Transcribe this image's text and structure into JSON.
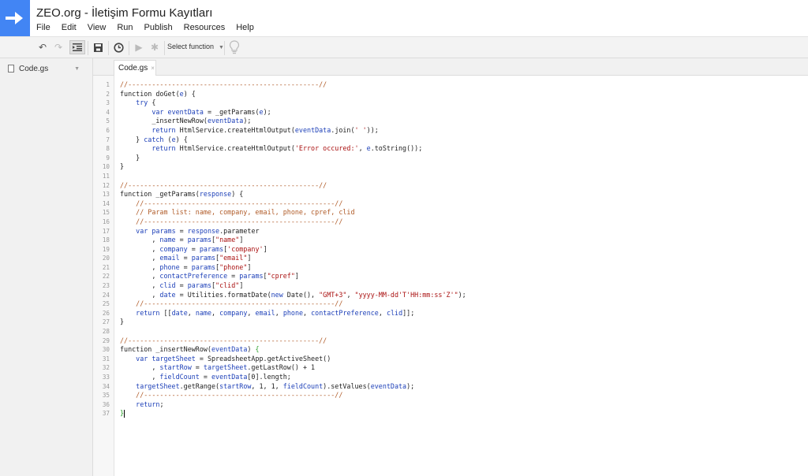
{
  "header": {
    "title": "ZEO.org - İletişim Formu Kayıtları",
    "menu": [
      "File",
      "Edit",
      "View",
      "Run",
      "Publish",
      "Resources",
      "Help"
    ]
  },
  "toolbar": {
    "select_function": "Select function"
  },
  "sidebar": {
    "file": "Code.gs"
  },
  "tabs": [
    {
      "label": "Code.gs",
      "close": "×"
    }
  ],
  "editor": {
    "lines": [
      [
        [
          "c",
          "//------------------------------------------------//"
        ]
      ],
      [
        [
          "p",
          "function doGet("
        ],
        [
          "v",
          "e"
        ],
        [
          "p",
          ") {"
        ]
      ],
      [
        [
          "p",
          "    "
        ],
        [
          "k",
          "try"
        ],
        [
          "p",
          " {"
        ]
      ],
      [
        [
          "p",
          "        "
        ],
        [
          "k",
          "var"
        ],
        [
          "p",
          " "
        ],
        [
          "v",
          "eventData"
        ],
        [
          "p",
          " = _getParams("
        ],
        [
          "v",
          "e"
        ],
        [
          "p",
          ");"
        ]
      ],
      [
        [
          "p",
          "        _insertNewRow("
        ],
        [
          "v",
          "eventData"
        ],
        [
          "p",
          ");"
        ]
      ],
      [
        [
          "p",
          "        "
        ],
        [
          "k",
          "return"
        ],
        [
          "p",
          " HtmlService.createHtmlOutput("
        ],
        [
          "v",
          "eventData"
        ],
        [
          "p",
          ".join("
        ],
        [
          "s",
          "' '"
        ],
        [
          "p",
          "));"
        ]
      ],
      [
        [
          "p",
          "    } "
        ],
        [
          "k",
          "catch"
        ],
        [
          "p",
          " ("
        ],
        [
          "v",
          "e"
        ],
        [
          "p",
          ") {"
        ]
      ],
      [
        [
          "p",
          "        "
        ],
        [
          "k",
          "return"
        ],
        [
          "p",
          " HtmlService.createHtmlOutput("
        ],
        [
          "s",
          "'Error occured:'"
        ],
        [
          "p",
          ", "
        ],
        [
          "v",
          "e"
        ],
        [
          "p",
          ".toString());"
        ]
      ],
      [
        [
          "p",
          "    }"
        ]
      ],
      [
        [
          "p",
          "}"
        ]
      ],
      [],
      [
        [
          "c",
          "//------------------------------------------------//"
        ]
      ],
      [
        [
          "p",
          "function _getParams("
        ],
        [
          "v",
          "response"
        ],
        [
          "p",
          ") {"
        ]
      ],
      [
        [
          "p",
          "    "
        ],
        [
          "c",
          "//------------------------------------------------//"
        ]
      ],
      [
        [
          "p",
          "    "
        ],
        [
          "c",
          "// Param list: name, company, email, phone, cpref, clid"
        ]
      ],
      [
        [
          "p",
          "    "
        ],
        [
          "c",
          "//------------------------------------------------//"
        ]
      ],
      [
        [
          "p",
          "    "
        ],
        [
          "k",
          "var"
        ],
        [
          "p",
          " "
        ],
        [
          "v",
          "params"
        ],
        [
          "p",
          " = "
        ],
        [
          "v",
          "response"
        ],
        [
          "p",
          ".parameter"
        ]
      ],
      [
        [
          "p",
          "        , "
        ],
        [
          "v",
          "name"
        ],
        [
          "p",
          " = "
        ],
        [
          "v",
          "params"
        ],
        [
          "p",
          "["
        ],
        [
          "s",
          "\"name\""
        ],
        [
          "p",
          "]"
        ]
      ],
      [
        [
          "p",
          "        , "
        ],
        [
          "v",
          "company"
        ],
        [
          "p",
          " = "
        ],
        [
          "v",
          "params"
        ],
        [
          "p",
          "["
        ],
        [
          "s",
          "'company'"
        ],
        [
          "p",
          "]"
        ]
      ],
      [
        [
          "p",
          "        , "
        ],
        [
          "v",
          "email"
        ],
        [
          "p",
          " = "
        ],
        [
          "v",
          "params"
        ],
        [
          "p",
          "["
        ],
        [
          "s",
          "\"email\""
        ],
        [
          "p",
          "]"
        ]
      ],
      [
        [
          "p",
          "        , "
        ],
        [
          "v",
          "phone"
        ],
        [
          "p",
          " = "
        ],
        [
          "v",
          "params"
        ],
        [
          "p",
          "["
        ],
        [
          "s",
          "\"phone\""
        ],
        [
          "p",
          "]"
        ]
      ],
      [
        [
          "p",
          "        , "
        ],
        [
          "v",
          "contactPreference"
        ],
        [
          "p",
          " = "
        ],
        [
          "v",
          "params"
        ],
        [
          "p",
          "["
        ],
        [
          "s",
          "\"cpref\""
        ],
        [
          "p",
          "]"
        ]
      ],
      [
        [
          "p",
          "        , "
        ],
        [
          "v",
          "clid"
        ],
        [
          "p",
          " = "
        ],
        [
          "v",
          "params"
        ],
        [
          "p",
          "["
        ],
        [
          "s",
          "\"clid\""
        ],
        [
          "p",
          "]"
        ]
      ],
      [
        [
          "p",
          "        , "
        ],
        [
          "v",
          "date"
        ],
        [
          "p",
          " = Utilities.formatDate("
        ],
        [
          "k",
          "new"
        ],
        [
          "p",
          " Date(), "
        ],
        [
          "s",
          "\"GMT+3\""
        ],
        [
          "p",
          ", "
        ],
        [
          "s",
          "\"yyyy-MM-dd'T'HH:mm:ss'Z'\""
        ],
        [
          "p",
          ");"
        ]
      ],
      [
        [
          "p",
          "    "
        ],
        [
          "c",
          "//------------------------------------------------//"
        ]
      ],
      [
        [
          "p",
          "    "
        ],
        [
          "k",
          "return"
        ],
        [
          "p",
          " [["
        ],
        [
          "v",
          "date"
        ],
        [
          "p",
          ", "
        ],
        [
          "v",
          "name"
        ],
        [
          "p",
          ", "
        ],
        [
          "v",
          "company"
        ],
        [
          "p",
          ", "
        ],
        [
          "v",
          "email"
        ],
        [
          "p",
          ", "
        ],
        [
          "v",
          "phone"
        ],
        [
          "p",
          ", "
        ],
        [
          "v",
          "contactPreference"
        ],
        [
          "p",
          ", "
        ],
        [
          "v",
          "clid"
        ],
        [
          "p",
          "]];"
        ]
      ],
      [
        [
          "p",
          "}"
        ]
      ],
      [],
      [
        [
          "c",
          "//------------------------------------------------//"
        ]
      ],
      [
        [
          "p",
          "function _insertNewRow("
        ],
        [
          "v",
          "eventData"
        ],
        [
          "p",
          ") "
        ],
        [
          "g",
          "{"
        ]
      ],
      [
        [
          "p",
          "    "
        ],
        [
          "k",
          "var"
        ],
        [
          "p",
          " "
        ],
        [
          "v",
          "targetSheet"
        ],
        [
          "p",
          " = SpreadsheetApp.getActiveSheet()"
        ]
      ],
      [
        [
          "p",
          "        , "
        ],
        [
          "v",
          "startRow"
        ],
        [
          "p",
          " = "
        ],
        [
          "v",
          "targetSheet"
        ],
        [
          "p",
          ".getLastRow() + 1"
        ]
      ],
      [
        [
          "p",
          "        , "
        ],
        [
          "v",
          "fieldCount"
        ],
        [
          "p",
          " = "
        ],
        [
          "v",
          "eventData"
        ],
        [
          "p",
          "[0].length;"
        ]
      ],
      [
        [
          "p",
          "    "
        ],
        [
          "v",
          "targetSheet"
        ],
        [
          "p",
          ".getRange("
        ],
        [
          "v",
          "startRow"
        ],
        [
          "p",
          ", 1, 1, "
        ],
        [
          "v",
          "fieldCount"
        ],
        [
          "p",
          ").setValues("
        ],
        [
          "v",
          "eventData"
        ],
        [
          "p",
          ");"
        ]
      ],
      [
        [
          "p",
          "    "
        ],
        [
          "c",
          "//------------------------------------------------//"
        ]
      ],
      [
        [
          "p",
          "    "
        ],
        [
          "k",
          "return"
        ],
        [
          "p",
          ";"
        ]
      ],
      [
        [
          "g",
          "}"
        ]
      ]
    ]
  }
}
